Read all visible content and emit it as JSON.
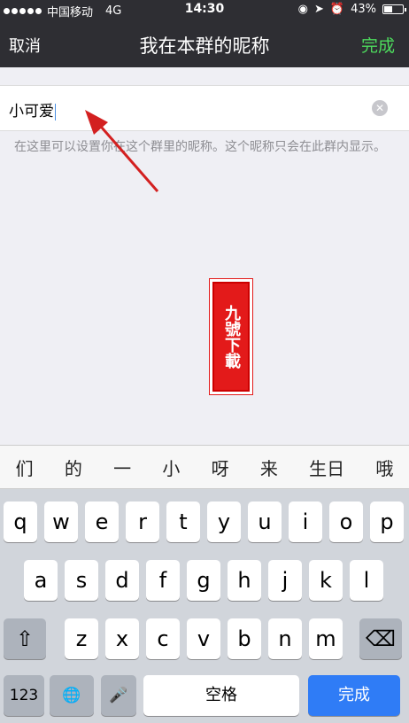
{
  "status": {
    "carrier": "中国移动",
    "network": "4G",
    "time": "14:30",
    "battery": "43%",
    "battery_level": 0.43
  },
  "nav": {
    "left_label": "取消",
    "title": "我在本群的昵称",
    "right_label": "完成",
    "right_color": "#4ddb5d"
  },
  "input": {
    "value": "小可爱",
    "clear_icon": "clear-icon"
  },
  "hint": "在这里可以设置你在这个群里的昵称。这个昵称只会在此群内显示。",
  "watermark": {
    "text": "九號下載"
  },
  "suggestions": [
    "们",
    "的",
    "一",
    "小",
    "呀",
    "来",
    "生日",
    "哦"
  ],
  "keyboard": {
    "row1": [
      "q",
      "w",
      "e",
      "r",
      "t",
      "y",
      "u",
      "i",
      "o",
      "p"
    ],
    "row2": [
      "a",
      "s",
      "d",
      "f",
      "g",
      "h",
      "j",
      "k",
      "l"
    ],
    "row3": [
      "z",
      "x",
      "c",
      "v",
      "b",
      "n",
      "m"
    ],
    "numbers_key": "123",
    "space_key": "空格",
    "return_key": "完成",
    "accent_color": "#2f7cf6"
  }
}
